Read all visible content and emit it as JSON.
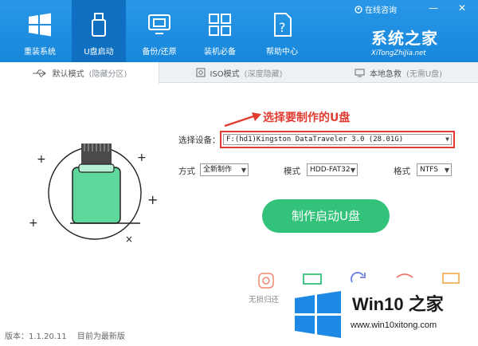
{
  "nav": {
    "items": [
      {
        "label": "重装系统",
        "icon": "windows-logo-icon"
      },
      {
        "label": "U盘启动",
        "icon": "usb-drive-icon"
      },
      {
        "label": "备份/还原",
        "icon": "backup-restore-icon"
      },
      {
        "label": "装机必备",
        "icon": "apps-grid-icon"
      },
      {
        "label": "帮助中心",
        "icon": "help-document-icon"
      }
    ],
    "active_index": 1
  },
  "titlebar": {
    "help_link": "在线咨询",
    "minimize": "—",
    "close": "✕"
  },
  "brand": {
    "title": "系统之家",
    "url": "XiTongZhiJia.net"
  },
  "tabs": [
    {
      "label": "默认模式",
      "sublabel": "(隐藏分区)"
    },
    {
      "label": "ISO模式",
      "sublabel": "(深度隐藏)"
    },
    {
      "label": "本地急救",
      "sublabel": "(无需U盘)"
    }
  ],
  "hint": "选择要制作的U盘",
  "form": {
    "device_label": "选择设备：",
    "device_value": "F:(hd1)Kingston DataTraveler 3.0 (28.01G)",
    "mode_label": "方式",
    "mode_value": "全新制作",
    "scheme_label": "模式",
    "scheme_value": "HDD-FAT32",
    "format_label": "格式",
    "format_value": "NTFS"
  },
  "make_button": "制作启动U盘",
  "tools": [
    {
      "label": "无损归还",
      "icon": "lossless-restore-icon"
    }
  ],
  "status": {
    "version": "版本：1.1.20.11",
    "latest": "目前为最新版"
  },
  "watermark": {
    "title": "Win10 之家",
    "url": "www.win10xitong.com"
  },
  "colors": {
    "header_blue": "#1687dc",
    "accent_green": "#33c27a",
    "alert_red": "#e03c31"
  }
}
